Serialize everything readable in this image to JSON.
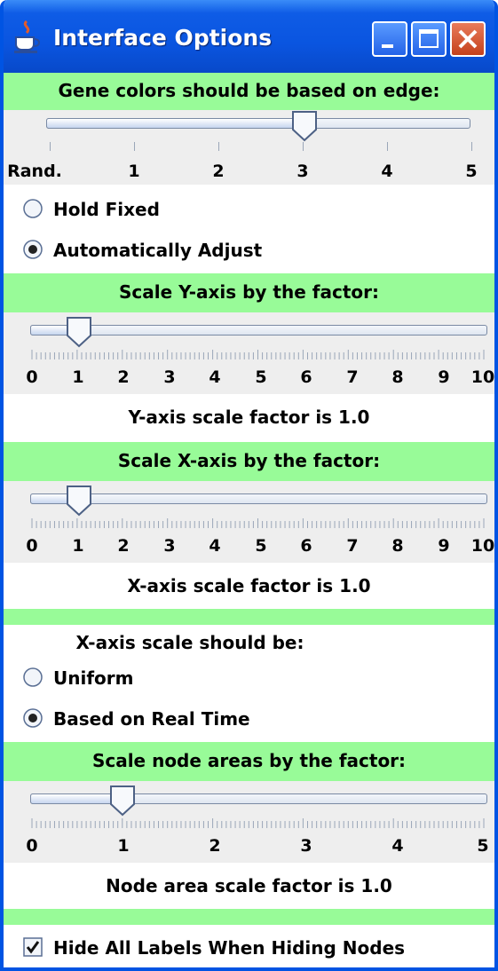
{
  "window": {
    "title": "Interface Options",
    "icon": "java-coffee-cup-icon",
    "controls": [
      "minimize-icon",
      "maximize-icon",
      "close-icon"
    ]
  },
  "gene_colors": {
    "heading": "Gene colors should be based on edge:",
    "ticks": [
      "Rand.",
      "1",
      "2",
      "3",
      "4",
      "5"
    ],
    "slider_value": 3,
    "slider_range": [
      0,
      5
    ]
  },
  "adjust_mode": {
    "options": [
      "Hold Fixed",
      "Automatically Adjust"
    ],
    "selected": "Automatically Adjust"
  },
  "y_axis": {
    "heading": "Scale Y-axis by the factor:",
    "ticks": [
      "0",
      "1",
      "2",
      "3",
      "4",
      "5",
      "6",
      "7",
      "8",
      "9",
      "10"
    ],
    "slider_value": 1,
    "slider_range": [
      0,
      10
    ],
    "status": "Y-axis scale factor is 1.0"
  },
  "x_axis": {
    "heading": "Scale X-axis by the factor:",
    "ticks": [
      "0",
      "1",
      "2",
      "3",
      "4",
      "5",
      "6",
      "7",
      "8",
      "9",
      "10"
    ],
    "slider_value": 1,
    "slider_range": [
      0,
      10
    ],
    "status": "X-axis scale factor is 1.0"
  },
  "x_scale_mode": {
    "heading": "X-axis scale should be:",
    "options": [
      "Uniform",
      "Based on Real Time"
    ],
    "selected": "Based on Real Time"
  },
  "node_area": {
    "heading": "Scale node areas by the factor:",
    "ticks": [
      "0",
      "1",
      "2",
      "3",
      "4",
      "5"
    ],
    "slider_value": 1,
    "slider_range": [
      0,
      5
    ],
    "status": "Node area scale factor is 1.0"
  },
  "hide_labels": {
    "label": "Hide All Labels When Hiding Nodes",
    "checked": true
  },
  "colors": {
    "band_green": "#98fb98",
    "titlebar_blue": "#0a55e0",
    "panel_gray": "#eeeeee"
  }
}
